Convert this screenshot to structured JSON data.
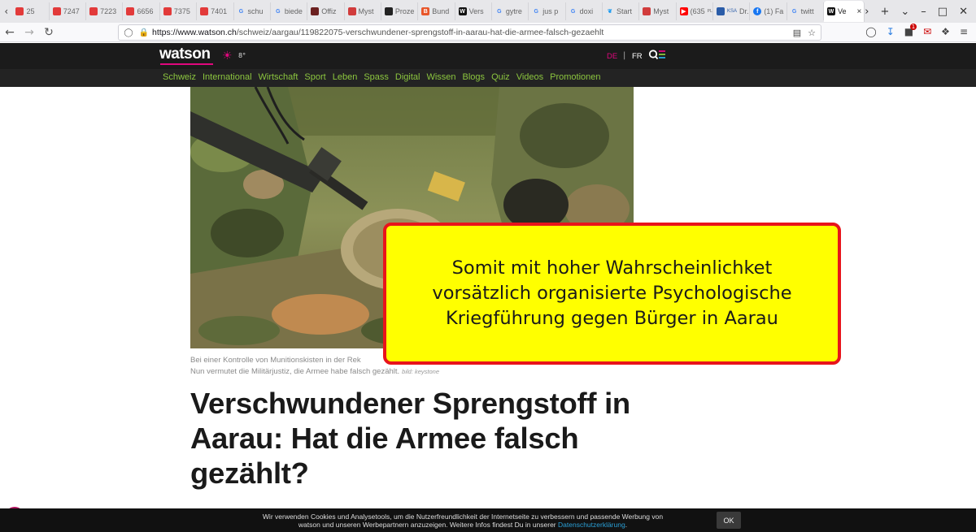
{
  "browser": {
    "tabs": [
      {
        "label": "25",
        "icon": "red-gradient-favicon",
        "color": "#e23a3a"
      },
      {
        "label": "7247",
        "icon": "red-gradient-favicon",
        "color": "#e23a3a"
      },
      {
        "label": "7223",
        "icon": "red-gradient-favicon",
        "color": "#e23a3a"
      },
      {
        "label": "6656",
        "icon": "red-gradient-favicon",
        "color": "#e23a3a"
      },
      {
        "label": "7375",
        "icon": "red-gradient-favicon",
        "color": "#e23a3a"
      },
      {
        "label": "7401",
        "icon": "red-gradient-favicon",
        "color": "#e23a3a"
      },
      {
        "label": "schu",
        "icon": "google-icon",
        "color": "#4285f4"
      },
      {
        "label": "biede",
        "icon": "google-icon",
        "color": "#4285f4"
      },
      {
        "label": "Offiz",
        "icon": "dark-favicon",
        "color": "#6b2020"
      },
      {
        "label": "Myst",
        "icon": "red-bird-favicon",
        "color": "#d13c3c"
      },
      {
        "label": "Proze",
        "icon": "dark-favicon",
        "color": "#222222"
      },
      {
        "label": "Bund",
        "icon": "orange-favicon",
        "color": "#e8562a"
      },
      {
        "label": "Vers",
        "icon": "watson-favicon",
        "color": "#111111"
      },
      {
        "label": "gytre",
        "icon": "google-icon",
        "color": "#4285f4"
      },
      {
        "label": "jus p",
        "icon": "google-icon",
        "color": "#4285f4"
      },
      {
        "label": "doxi",
        "icon": "google-icon",
        "color": "#4285f4"
      },
      {
        "label": "Start",
        "icon": "twitter-icon",
        "color": "#1d9bf0"
      },
      {
        "label": "Myst",
        "icon": "red-bird-favicon",
        "color": "#d13c3c"
      },
      {
        "label": "(635",
        "sublabel": "PLAYLI",
        "icon": "youtube-icon",
        "color": "#ff0000"
      },
      {
        "label": "Dr. n",
        "icon": "ksa-favicon",
        "color": "#2a5ca8",
        "prefix": "KSA"
      },
      {
        "label": "(1) Fa",
        "icon": "facebook-icon",
        "color": "#1877f2"
      },
      {
        "label": "twitt",
        "icon": "google-icon",
        "color": "#4285f4"
      }
    ],
    "active_tab": {
      "label": "Ve",
      "icon": "watson-favicon",
      "close": "×"
    },
    "new_tab": "+",
    "url_host": "https://www.watson.ch",
    "url_path": "/schweiz/aargau/119822075-verschwundener-sprengstoff-in-aarau-hat-die-armee-falsch-gezaehlt",
    "notification_count": "1"
  },
  "site": {
    "logo": "watson",
    "weather": "8°",
    "lang_de": "DE",
    "lang_sep": "|",
    "lang_fr": "FR",
    "brand_color": "#e0077d",
    "nav_color": "#8cc63f",
    "nav": [
      "Schweiz",
      "International",
      "Wirtschaft",
      "Sport",
      "Leben",
      "Spass",
      "Digital",
      "Wissen",
      "Blogs",
      "Quiz",
      "Videos",
      "Promotionen"
    ]
  },
  "article": {
    "caption_line1": "Bei einer Kontrolle von Munitionskisten in der Rek",
    "caption_line2": "Nun vermutet die Militärjustiz, die Armee habe falsch gezählt.",
    "credit": "bild: keystone",
    "headline": "Verschwundener Sprengstoff in Aarau: Hat die Armee falsch gezählt?"
  },
  "callout": {
    "text": "Somit mit hoher Wahrscheinlichket vorsätzlich organisierte Psychologische Kriegführung gegen Bürger in Aarau",
    "bg": "#ffff00",
    "border": "#e8141b"
  },
  "cookie": {
    "text1": "Wir verwenden Cookies und Analysetools, um die Nutzerfreundlichkeit der Internetseite zu verbessern und passende Werbung von",
    "text2": "watson und unseren Werbepartnern anzuzeigen. Weitere Infos findest Du in unserer ",
    "link": "Datenschutzerklärung",
    "suffix": ".",
    "ok": "OK"
  }
}
